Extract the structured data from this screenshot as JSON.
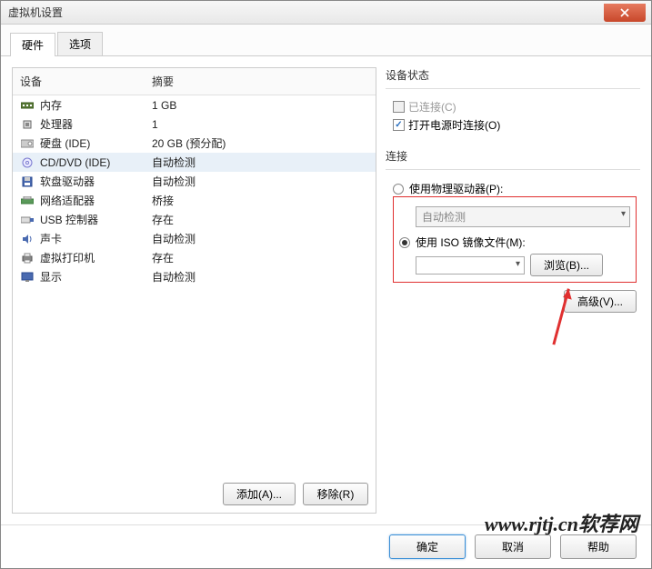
{
  "window": {
    "title": "虚拟机设置"
  },
  "tabs": {
    "hardware": "硬件",
    "options": "选项"
  },
  "hw_header": {
    "device": "设备",
    "summary": "摘要"
  },
  "hw_items": [
    {
      "icon": "memory",
      "name": "内存",
      "summary": "1 GB"
    },
    {
      "icon": "cpu",
      "name": "处理器",
      "summary": "1"
    },
    {
      "icon": "disk",
      "name": "硬盘 (IDE)",
      "summary": "20 GB (预分配)"
    },
    {
      "icon": "cd",
      "name": "CD/DVD (IDE)",
      "summary": "自动检测"
    },
    {
      "icon": "floppy",
      "name": "软盘驱动器",
      "summary": "自动检测"
    },
    {
      "icon": "net",
      "name": "网络适配器",
      "summary": "桥接"
    },
    {
      "icon": "usb",
      "name": "USB 控制器",
      "summary": "存在"
    },
    {
      "icon": "sound",
      "name": "声卡",
      "summary": "自动检测"
    },
    {
      "icon": "printer",
      "name": "虚拟打印机",
      "summary": "存在"
    },
    {
      "icon": "display",
      "name": "显示",
      "summary": "自动检测"
    }
  ],
  "hw_buttons": {
    "add": "添加(A)...",
    "remove": "移除(R)"
  },
  "status_group": {
    "title": "设备状态",
    "connected": "已连接(C)",
    "poweron": "打开电源时连接(O)"
  },
  "connect_group": {
    "title": "连接",
    "physical": "使用物理驱动器(P):",
    "phys_combo": "自动检测",
    "iso": "使用 ISO 镜像文件(M):",
    "iso_value": "",
    "browse": "浏览(B)..."
  },
  "advanced": "高级(V)...",
  "footer": {
    "ok": "确定",
    "cancel": "取消",
    "help": "帮助"
  },
  "watermark": "www.rjtj.cn软荐网"
}
